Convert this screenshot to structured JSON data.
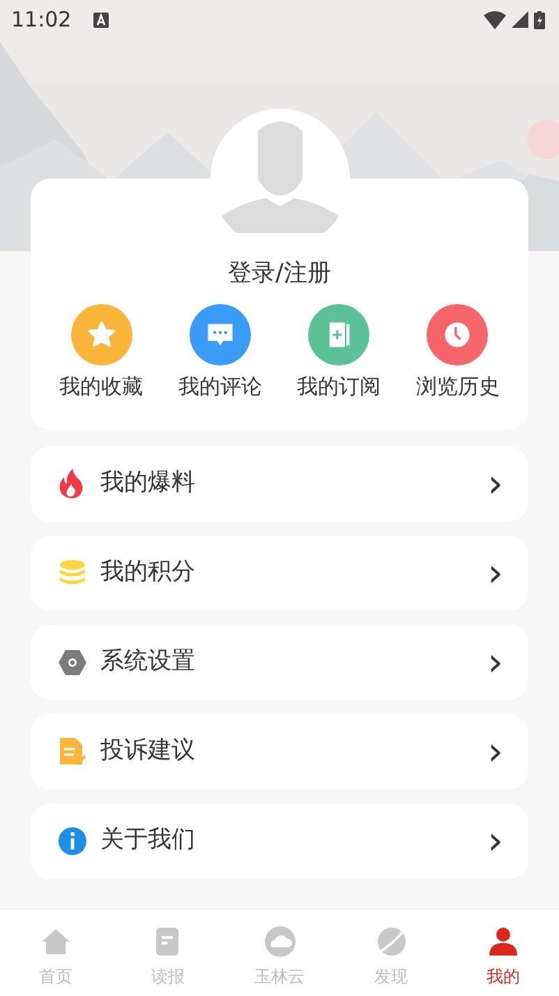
{
  "status_bar": {
    "time": "11:02"
  },
  "profile": {
    "login_label": "登录/注册"
  },
  "shortcuts": [
    {
      "label": "我的收藏",
      "color": "#fbb53a"
    },
    {
      "label": "我的评论",
      "color": "#3a9cf6"
    },
    {
      "label": "我的订阅",
      "color": "#5cc197"
    },
    {
      "label": "浏览历史",
      "color": "#f5666a"
    }
  ],
  "menu": [
    {
      "label": "我的爆料",
      "chevron": "›"
    },
    {
      "label": "我的积分",
      "chevron": "›"
    },
    {
      "label": "系统设置",
      "chevron": "›"
    },
    {
      "label": "投诉建议",
      "chevron": "›"
    },
    {
      "label": "关于我们",
      "chevron": "›"
    }
  ],
  "tabs": [
    {
      "label": "首页",
      "selected": false
    },
    {
      "label": "读报",
      "selected": false
    },
    {
      "label": "玉林云",
      "selected": false
    },
    {
      "label": "发现",
      "selected": false
    },
    {
      "label": "我的",
      "selected": true
    }
  ]
}
